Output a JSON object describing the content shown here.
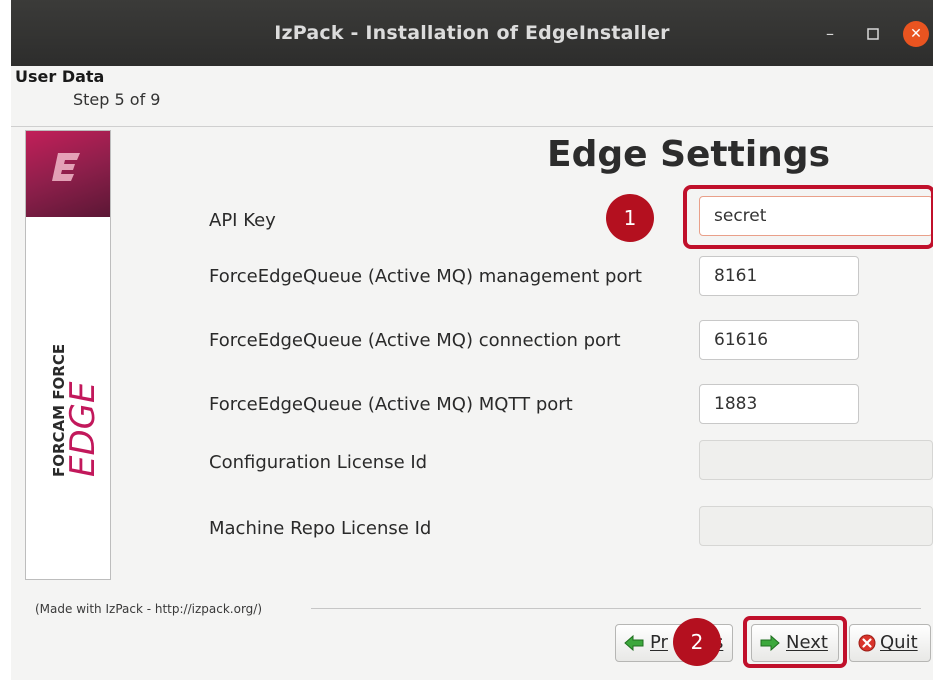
{
  "window": {
    "title": "IzPack - Installation of  EdgeInstaller",
    "controls": {
      "minimize_icon": "minimize-icon",
      "maximize_icon": "maximize-icon",
      "close_icon": "close-icon"
    }
  },
  "header": {
    "heading": "User Data",
    "step": "Step 5 of 9"
  },
  "banner": {
    "brand_small": "FORCAM FORCE",
    "brand_large": "EDGE",
    "trademark": "™"
  },
  "content": {
    "title": "Edge Settings",
    "fields": [
      {
        "label": "API Key",
        "value": "secret",
        "enabled": true
      },
      {
        "label": "ForceEdgeQueue (Active MQ) management port",
        "value": "8161",
        "enabled": true
      },
      {
        "label": "ForceEdgeQueue (Active MQ) connection port",
        "value": "61616",
        "enabled": true
      },
      {
        "label": "ForceEdgeQueue (Active MQ) MQTT port",
        "value": "1883",
        "enabled": true
      },
      {
        "label": "Configuration License Id",
        "value": "",
        "enabled": false
      },
      {
        "label": "Machine Repo License Id",
        "value": "",
        "enabled": false
      }
    ]
  },
  "annotations": {
    "badge1": "1",
    "badge2": "2",
    "highlight_color": "#c0102b"
  },
  "footer": {
    "credit": "(Made with IzPack - http://izpack.org/)",
    "buttons": {
      "previous_left": "Pr",
      "previous_right": "s",
      "next": "Next",
      "quit": "Quit"
    }
  },
  "colors": {
    "titlebar": "#2d2d2c",
    "close_button": "#e95420",
    "banner_accent": "#b8205a",
    "badge": "#b4101f"
  }
}
